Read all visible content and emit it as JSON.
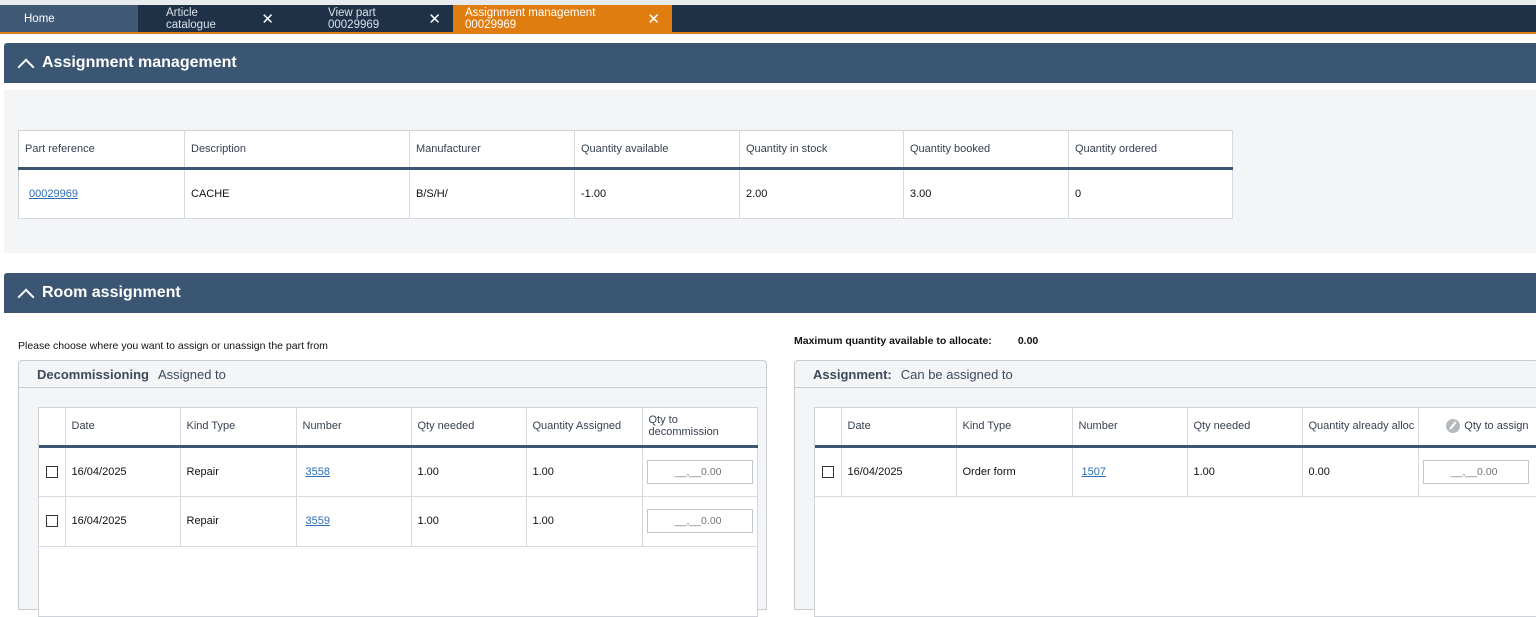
{
  "tabs": [
    {
      "label": "Home",
      "closable": false,
      "active": false
    },
    {
      "label": "Article catalogue",
      "closable": true,
      "active": false
    },
    {
      "label": "View part 00029969",
      "closable": true,
      "active": false
    },
    {
      "label": "Assignment management 00029969",
      "closable": true,
      "active": true
    }
  ],
  "assignment_section": {
    "title": "Assignment management",
    "columns": [
      "Part reference",
      "Description",
      "Manufacturer",
      "Quantity available",
      "Quantity in stock",
      "Quantity booked",
      "Quantity ordered"
    ],
    "row": {
      "part_reference": "00029969",
      "description": "CACHE",
      "manufacturer": "B/S/H/",
      "qty_available": "-1.00",
      "qty_in_stock": "2.00",
      "qty_booked": "3.00",
      "qty_ordered": "0"
    }
  },
  "room_section": {
    "title": "Room assignment",
    "note": "Please choose where you want to assign or unassign the part from",
    "max_label": "Maximum quantity available to allocate:",
    "max_value": "0.00",
    "decommissioning": {
      "title_bold": "Decommissioning",
      "title_rest": "Assigned to",
      "columns": [
        "Date",
        "Kind Type",
        "Number",
        "Qty needed",
        "Quantity Assigned",
        "Qty to decommission"
      ],
      "rows": [
        {
          "date": "16/04/2025",
          "kind": "Repair",
          "number": "3558",
          "qty_needed": "1.00",
          "qty_assigned": "1.00",
          "placeholder": "__,__0.00"
        },
        {
          "date": "16/04/2025",
          "kind": "Repair",
          "number": "3559",
          "qty_needed": "1.00",
          "qty_assigned": "1.00",
          "placeholder": "__,__0.00"
        }
      ]
    },
    "assignment": {
      "title_bold": "Assignment:",
      "title_rest": "Can be assigned to",
      "columns": [
        "Date",
        "Kind Type",
        "Number",
        "Qty needed",
        "Quantity already alloc",
        "Qty to assign"
      ],
      "rows": [
        {
          "date": "16/04/2025",
          "kind": "Order form",
          "number": "1507",
          "qty_needed": "1.00",
          "qty_already": "0.00",
          "placeholder": "__,__0.00"
        }
      ]
    }
  }
}
